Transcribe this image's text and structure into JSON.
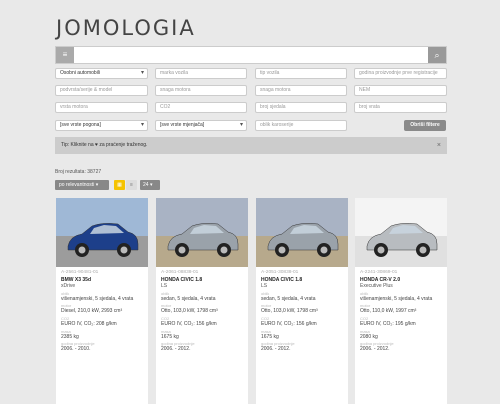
{
  "logo": "JOMOLOGIA",
  "search": {
    "value": ""
  },
  "filters": {
    "row1": [
      "Osobni automobili",
      "marka vozila",
      "tip vozila",
      "godina proizvodnje prve registracije"
    ],
    "row2": [
      "podvrsta/serije & model",
      "snaga motora",
      "snaga motora",
      "NEM"
    ],
    "row3": [
      "vrsta motora",
      "CO2",
      "broj sjedala",
      "broj vrata"
    ],
    "row4": [
      "[sve vrste pogona]",
      "[sve vrste mjenjača]",
      "oblik karoserije"
    ],
    "submit": "Obriši filtere"
  },
  "tip": {
    "text": "Tip: Kliknite na ♥ za praćenje traženog.",
    "close": "×"
  },
  "results": {
    "count_label": "Broj rezultata: 38727",
    "sort": "po relevantnosti ▾",
    "per_page": "24 ▾"
  },
  "colors": {
    "accent": "#f5c300"
  },
  "cars": [
    {
      "code": "A-2561-90481-01",
      "name": "BMW X3 35d",
      "sub": "xDrive",
      "lbl1": "oblik",
      "body": "višenamjenski, 5 sjedala, 4 vrata",
      "lbl2": "motor",
      "engine": "Diesel, 210,0 kW, 2993 cm³",
      "lbl3": "CO2",
      "co2": "EURO IV, CO₂: 208 g/km",
      "lbl4": "masa",
      "mass": "2385 kg",
      "lbl5": "godina proizvodnje",
      "years": "2006. - 2010.",
      "color": "#1d3f8a"
    },
    {
      "code": "A-2061-08838-01",
      "name": "HONDA CIVIC 1.8",
      "sub": "LS",
      "lbl1": "oblik",
      "body": "sedan, 5 sjedala, 4 vrata",
      "lbl2": "motor",
      "engine": "Otto, 103,0 kW, 1798 cm³",
      "lbl3": "CO2",
      "co2": "EURO IV, CO₂: 156 g/km",
      "lbl4": "masa",
      "mass": "1675 kg",
      "lbl5": "godina proizvodnje",
      "years": "2006. - 2012.",
      "color": "#9aa2aa"
    },
    {
      "code": "A-2051-30838-01",
      "name": "HONDA CIVIC 1.8",
      "sub": "LS",
      "lbl1": "oblik",
      "body": "sedan, 5 sjedala, 4 vrata",
      "lbl2": "motor",
      "engine": "Otto, 103,0 kW, 1798 cm³",
      "lbl3": "CO2",
      "co2": "EURO IV, CO₂: 156 g/km",
      "lbl4": "masa",
      "mass": "1675 kg",
      "lbl5": "godina proizvodnje",
      "years": "2006. - 2012.",
      "color": "#9aa2aa"
    },
    {
      "code": "A-2241-30869-01",
      "name": "HONDA CR-V 2.0",
      "sub": "Executive Plus",
      "lbl1": "oblik",
      "body": "višenamjenski, 5 sjedala, 4 vrata",
      "lbl2": "motor",
      "engine": "Otto, 110,0 kW, 1997 cm³",
      "lbl3": "CO2",
      "co2": "EURO IV, CO₂: 195 g/km",
      "lbl4": "masa",
      "mass": "2080 kg",
      "lbl5": "godina proizvodnje",
      "years": "2006. - 2012.",
      "color": "#b8bcc0"
    }
  ]
}
